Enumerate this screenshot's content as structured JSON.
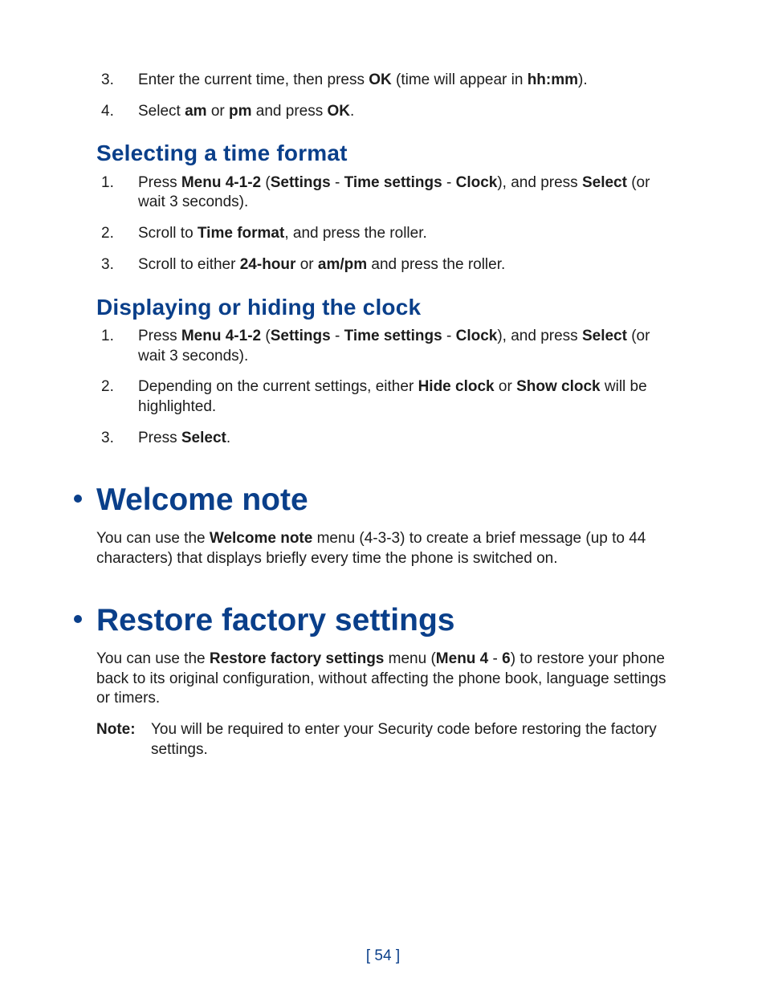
{
  "intro_items": [
    {
      "num": "3.",
      "segments": [
        {
          "t": "Enter the current time, then press "
        },
        {
          "t": "OK",
          "b": true
        },
        {
          "t": " (time will appear in "
        },
        {
          "t": "hh:mm",
          "b": true
        },
        {
          "t": ")."
        }
      ]
    },
    {
      "num": "4.",
      "segments": [
        {
          "t": "Select "
        },
        {
          "t": "am",
          "b": true
        },
        {
          "t": " or "
        },
        {
          "t": "pm",
          "b": true
        },
        {
          "t": " and press "
        },
        {
          "t": "OK",
          "b": true
        },
        {
          "t": "."
        }
      ]
    }
  ],
  "sec1": {
    "heading": "Selecting a time format",
    "items": [
      {
        "num": "1.",
        "segments": [
          {
            "t": "Press "
          },
          {
            "t": "Menu 4-1-2",
            "b": true
          },
          {
            "t": " ("
          },
          {
            "t": "Settings",
            "b": true
          },
          {
            "t": " - "
          },
          {
            "t": "Time settings",
            "b": true
          },
          {
            "t": " - "
          },
          {
            "t": "Clock",
            "b": true
          },
          {
            "t": "), and press "
          },
          {
            "t": "Select",
            "b": true
          },
          {
            "t": " (or wait 3 seconds)."
          }
        ]
      },
      {
        "num": "2.",
        "segments": [
          {
            "t": "Scroll to "
          },
          {
            "t": "Time format",
            "b": true
          },
          {
            "t": ", and press the roller."
          }
        ]
      },
      {
        "num": "3.",
        "segments": [
          {
            "t": "Scroll to either "
          },
          {
            "t": "24-hour",
            "b": true
          },
          {
            "t": " or "
          },
          {
            "t": "am/pm",
            "b": true
          },
          {
            "t": " and press the roller."
          }
        ]
      }
    ]
  },
  "sec2": {
    "heading": "Displaying or hiding the clock",
    "items": [
      {
        "num": "1.",
        "segments": [
          {
            "t": "Press "
          },
          {
            "t": "Menu 4-1-2",
            "b": true
          },
          {
            "t": " ("
          },
          {
            "t": "Settings",
            "b": true
          },
          {
            "t": " - "
          },
          {
            "t": "Time settings",
            "b": true
          },
          {
            "t": " - "
          },
          {
            "t": "Clock",
            "b": true
          },
          {
            "t": "), and press "
          },
          {
            "t": "Select",
            "b": true
          },
          {
            "t": " (or wait 3 seconds)."
          }
        ]
      },
      {
        "num": "2.",
        "segments": [
          {
            "t": "Depending on the current settings, either "
          },
          {
            "t": "Hide clock",
            "b": true
          },
          {
            "t": " or "
          },
          {
            "t": "Show clock",
            "b": true
          },
          {
            "t": " will be highlighted."
          }
        ]
      },
      {
        "num": "3.",
        "segments": [
          {
            "t": "Press "
          },
          {
            "t": "Select",
            "b": true
          },
          {
            "t": "."
          }
        ]
      }
    ]
  },
  "welcome": {
    "heading": "Welcome note",
    "para_segments": [
      {
        "t": "You can use the "
      },
      {
        "t": "Welcome note",
        "b": true
      },
      {
        "t": " menu (4-3-3) to create a brief message (up to 44 characters) that displays briefly every time the phone is switched on."
      }
    ]
  },
  "restore": {
    "heading": "Restore factory settings",
    "para_segments": [
      {
        "t": "You can use the "
      },
      {
        "t": "Restore factory settings",
        "b": true
      },
      {
        "t": " menu ("
      },
      {
        "t": "Menu 4",
        "b": true
      },
      {
        "t": " - "
      },
      {
        "t": "6",
        "b": true
      },
      {
        "t": ") to restore your phone back to its original configuration, without affecting the phone book, language settings or timers."
      }
    ],
    "note_label": "Note:",
    "note_body": "You will be required to enter your Security code before restoring the factory settings."
  },
  "page_number": "[ 54 ]"
}
